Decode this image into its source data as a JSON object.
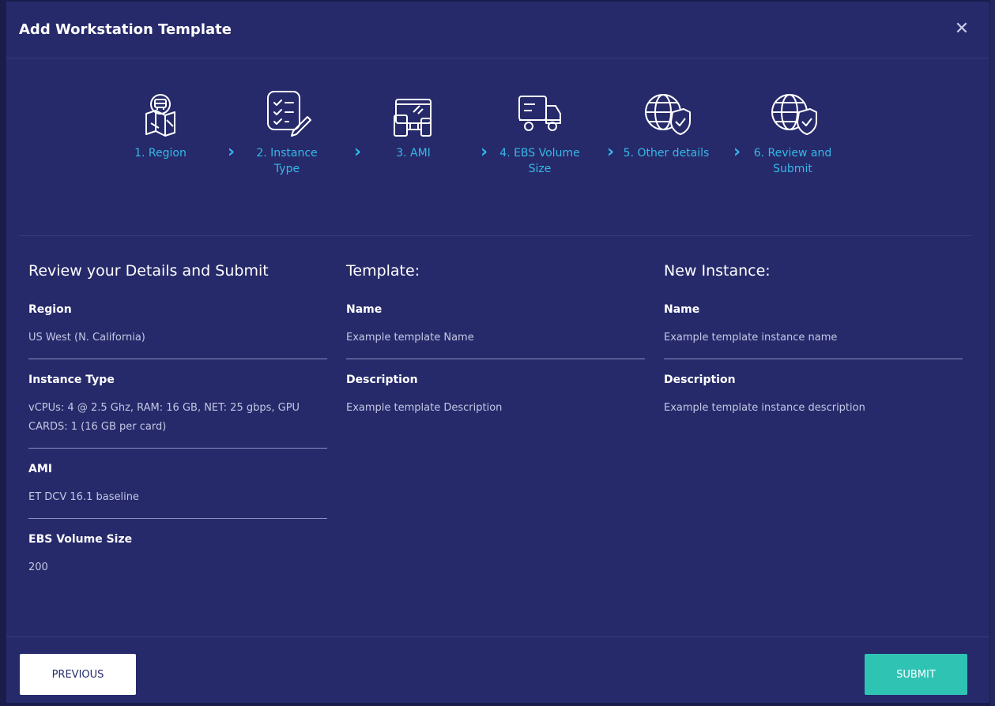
{
  "modal": {
    "title": "Add Workstation Template",
    "close_icon": "close-icon"
  },
  "steps": [
    {
      "label": "1. Region",
      "icon": "map-icon"
    },
    {
      "label": "2. Instance Type",
      "icon": "checklist-icon"
    },
    {
      "label": "3. AMI",
      "icon": "devices-icon"
    },
    {
      "label": "4. EBS Volume Size",
      "icon": "truck-icon"
    },
    {
      "label": "5. Other details",
      "icon": "globe-shield-icon"
    },
    {
      "label": "6. Review and Submit",
      "icon": "globe-shield-icon"
    }
  ],
  "review": {
    "title": "Review your Details and Submit",
    "fields": [
      {
        "label": "Region",
        "value": "US West (N. California)"
      },
      {
        "label": "Instance Type",
        "value": "vCPUs: 4 @ 2.5 Ghz, RAM: 16 GB, NET: 25 gbps, GPU CARDS: 1 (16 GB per card)"
      },
      {
        "label": "AMI",
        "value": "ET DCV 16.1 baseline"
      },
      {
        "label": "EBS Volume Size",
        "value": "200"
      }
    ]
  },
  "template": {
    "title": "Template:",
    "fields": [
      {
        "label": "Name",
        "value": "Example template Name"
      },
      {
        "label": "Description",
        "value": "Example template Description"
      }
    ]
  },
  "new_instance": {
    "title": "New Instance:",
    "fields": [
      {
        "label": "Name",
        "value": "Example template instance name"
      },
      {
        "label": "Description",
        "value": "Example template instance description"
      }
    ]
  },
  "footer": {
    "previous_label": "PREVIOUS",
    "submit_label": "SUBMIT"
  },
  "colors": {
    "background": "#262a6a",
    "accent": "#36b8e8",
    "submit": "#2fc3b4"
  }
}
